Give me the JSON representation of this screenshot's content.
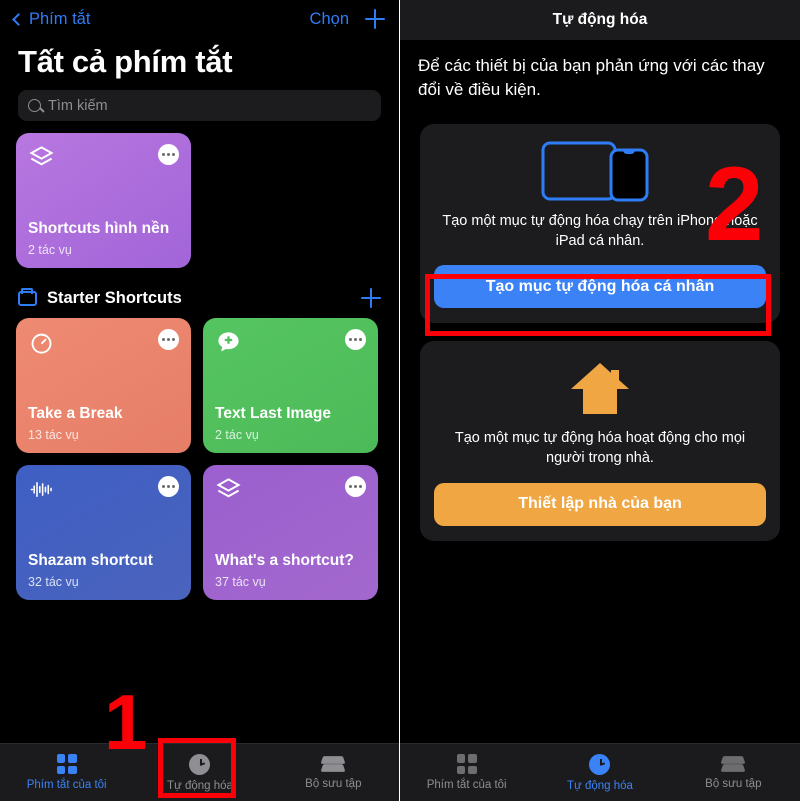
{
  "left": {
    "nav": {
      "back_label": "Phím tắt",
      "choose_label": "Chọn",
      "add_icon": "plus-icon"
    },
    "title": "Tất cả phím tắt",
    "search": {
      "placeholder": "Tìm kiếm",
      "icon": "search-icon"
    },
    "featured_card": {
      "name": "Shortcuts hình nền",
      "subtitle": "2 tác vụ",
      "icon": "stack-icon",
      "color": "#b06fd8"
    },
    "folder": {
      "label": "Starter Shortcuts",
      "icon": "folder-icon",
      "add_icon": "plus-icon"
    },
    "shortcuts": [
      {
        "name": "Take a Break",
        "subtitle": "13 tác vụ",
        "icon": "timer-icon",
        "color": "#ea8370"
      },
      {
        "name": "Text Last Image",
        "subtitle": "2 tác vụ",
        "icon": "message-plus-icon",
        "color": "#51c05c"
      },
      {
        "name": "Shazam shortcut",
        "subtitle": "32 tác vụ",
        "icon": "waveform-icon",
        "color": "#4460c0"
      },
      {
        "name": "What's a shortcut?",
        "subtitle": "37 tác vụ",
        "icon": "stack-icon",
        "color": "#9e63cd"
      }
    ],
    "tabs": [
      {
        "label": "Phím tắt của tôi",
        "icon": "grid-icon",
        "active": true
      },
      {
        "label": "Tự động hóa",
        "icon": "clock-check-icon",
        "active": false
      },
      {
        "label": "Bộ sưu tập",
        "icon": "stack-icon",
        "active": false
      }
    ],
    "annotation": {
      "number": "1",
      "highlight_target": "Tự động hóa",
      "color": "#fb0007"
    }
  },
  "right": {
    "nav_title": "Tự động hóa",
    "intro": "Để các thiết bị của bạn phản ứng với các thay đổi về điều kiện.",
    "cards": [
      {
        "icon": "ipad-iphone-icon",
        "description": "Tạo một mục tự động hóa chạy trên iPhone hoặc iPad cá nhân.",
        "button_label": "Tạo mục tự động hóa cá nhân",
        "button_color": "#3b82f6"
      },
      {
        "icon": "house-icon",
        "description": "Tạo một mục tự động hóa hoạt động cho mọi người trong nhà.",
        "button_label": "Thiết lập nhà của bạn",
        "button_color": "#efa643"
      }
    ],
    "tabs": [
      {
        "label": "Phím tắt của tôi",
        "icon": "grid-icon",
        "active": false
      },
      {
        "label": "Tự động hóa",
        "icon": "clock-check-icon",
        "active": true
      },
      {
        "label": "Bộ sưu tập",
        "icon": "stack-icon",
        "active": false
      }
    ],
    "annotation": {
      "number": "2",
      "highlight_target": "Tạo mục tự động hóa cá nhân",
      "color": "#fb0007"
    }
  }
}
